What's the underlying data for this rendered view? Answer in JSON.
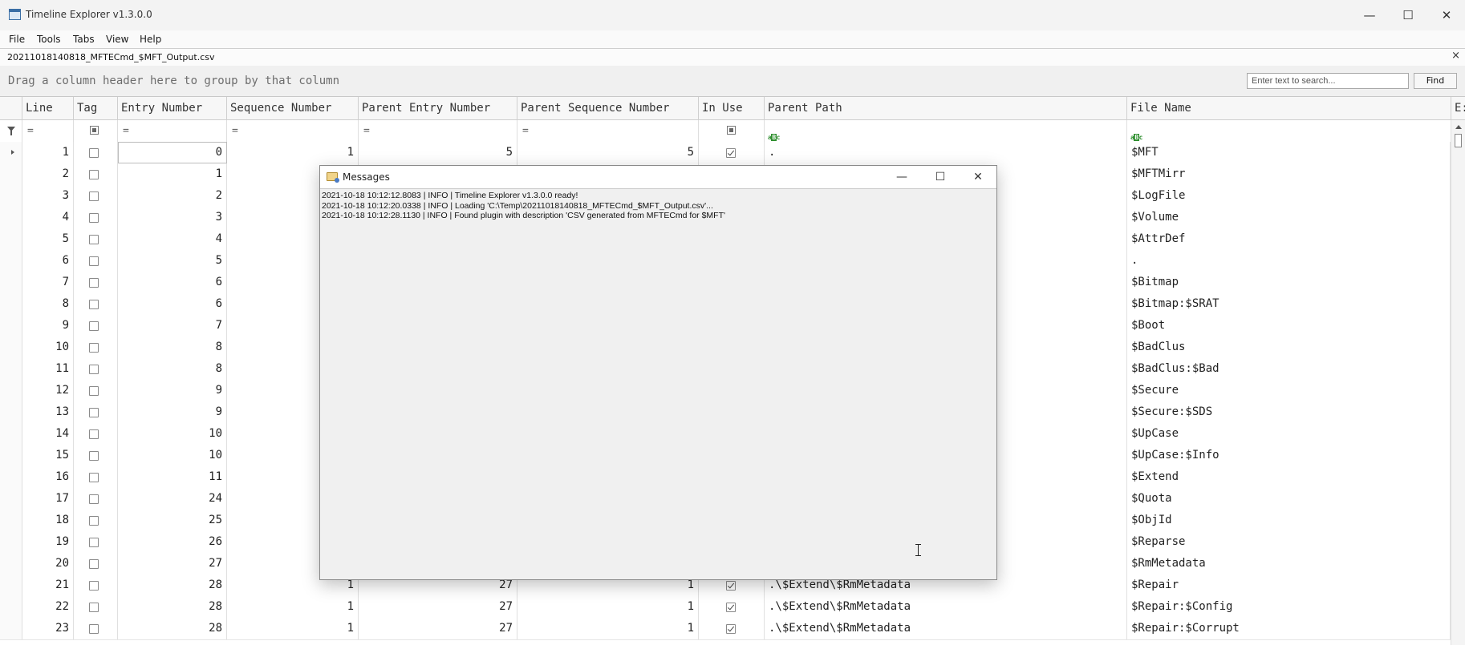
{
  "window": {
    "title": "Timeline Explorer v1.3.0.0",
    "minimize_glyph": "—",
    "maximize_glyph": "☐",
    "close_glyph": "✕"
  },
  "menu": [
    "File",
    "Tools",
    "Tabs",
    "View",
    "Help"
  ],
  "tab": {
    "label": "20211018140818_MFTECmd_$MFT_Output.csv",
    "close_glyph": "×"
  },
  "groupbar": {
    "hint": "Drag a column header here to group by that column",
    "search_placeholder": "Enter text to search...",
    "find_label": "Find"
  },
  "columns": [
    "Line",
    "Tag",
    "Entry Number",
    "Sequence Number",
    "Parent Entry Number",
    "Parent Sequence Number",
    "In Use",
    "Parent Path",
    "File Name",
    "E:"
  ],
  "filters": {
    "eq": "="
  },
  "rows": [
    {
      "line": "1",
      "entry": "0",
      "seq": "1",
      "pentry": "5",
      "pseq": "5",
      "inuse": true,
      "ppath": ".",
      "fname": "$MFT"
    },
    {
      "line": "2",
      "entry": "1",
      "fname": "$MFTMirr"
    },
    {
      "line": "3",
      "entry": "2",
      "fname": "$LogFile"
    },
    {
      "line": "4",
      "entry": "3",
      "fname": "$Volume"
    },
    {
      "line": "5",
      "entry": "4",
      "fname": "$AttrDef"
    },
    {
      "line": "6",
      "entry": "5",
      "fname": "."
    },
    {
      "line": "7",
      "entry": "6",
      "fname": "$Bitmap"
    },
    {
      "line": "8",
      "entry": "6",
      "fname": "$Bitmap:$SRAT"
    },
    {
      "line": "9",
      "entry": "7",
      "fname": "$Boot"
    },
    {
      "line": "10",
      "entry": "8",
      "fname": "$BadClus"
    },
    {
      "line": "11",
      "entry": "8",
      "fname": "$BadClus:$Bad"
    },
    {
      "line": "12",
      "entry": "9",
      "fname": "$Secure"
    },
    {
      "line": "13",
      "entry": "9",
      "fname": "$Secure:$SDS"
    },
    {
      "line": "14",
      "entry": "10",
      "fname": "$UpCase"
    },
    {
      "line": "15",
      "entry": "10",
      "fname": "$UpCase:$Info"
    },
    {
      "line": "16",
      "entry": "11",
      "fname": "$Extend"
    },
    {
      "line": "17",
      "entry": "24",
      "fname": "$Quota"
    },
    {
      "line": "18",
      "entry": "25",
      "fname": "$ObjId"
    },
    {
      "line": "19",
      "entry": "26",
      "fname": "$Reparse"
    },
    {
      "line": "20",
      "entry": "27",
      "fname": "$RmMetadata"
    },
    {
      "line": "21",
      "entry": "28",
      "seq": "1",
      "pentry": "27",
      "pseq": "1",
      "inuse": true,
      "ppath": ".\\$Extend\\$RmMetadata",
      "fname": "$Repair"
    },
    {
      "line": "22",
      "entry": "28",
      "seq": "1",
      "pentry": "27",
      "pseq": "1",
      "inuse": true,
      "ppath": ".\\$Extend\\$RmMetadata",
      "fname": "$Repair:$Config"
    },
    {
      "line": "23",
      "entry": "28",
      "seq": "1",
      "pentry": "27",
      "pseq": "1",
      "inuse": true,
      "ppath": ".\\$Extend\\$RmMetadata",
      "fname": "$Repair:$Corrupt"
    }
  ],
  "messages_dialog": {
    "title": "Messages",
    "lines": [
      "2021-10-18 10:12:12.8083 | INFO | Timeline Explorer v1.3.0.0 ready!",
      "2021-10-18 10:12:20.0338 | INFO | Loading 'C:\\Temp\\20211018140818_MFTECmd_$MFT_Output.csv'...",
      "2021-10-18 10:12:28.1130 | INFO | Found plugin with description 'CSV generated from MFTECmd for $MFT'"
    ]
  },
  "colors": {
    "accent": "#3a6ea5",
    "grid_border": "#cfcfcf",
    "header_bg": "#f7f7f7"
  }
}
